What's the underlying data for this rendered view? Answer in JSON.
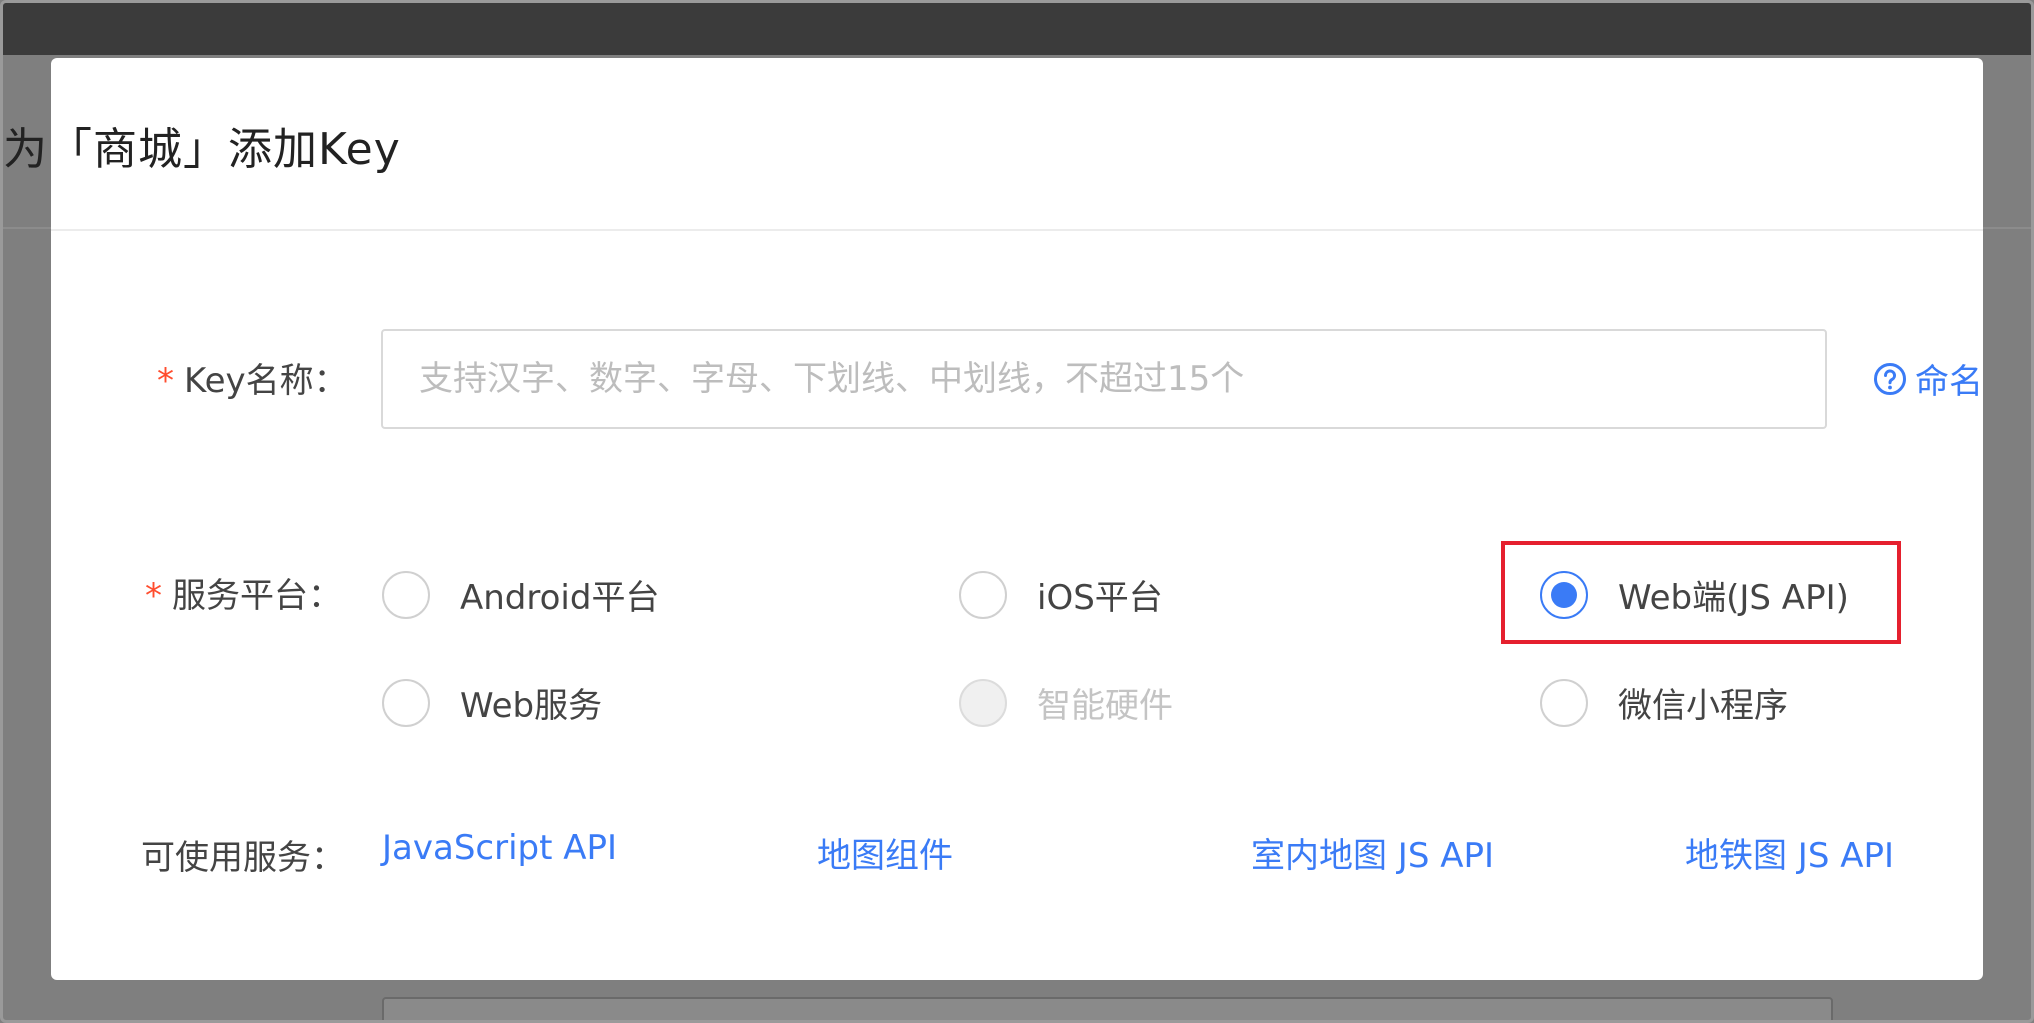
{
  "dialog": {
    "title": "为「商城」添加Key"
  },
  "key_name": {
    "required_mark": "*",
    "label": "Key名称：",
    "placeholder": "支持汉字、数字、字母、下划线、中划线，不超过15个",
    "value": "",
    "help_link": "命名规",
    "help_icon": "question-circle-icon"
  },
  "platform": {
    "required_mark": "*",
    "label": "服务平台：",
    "options": [
      {
        "label": "Android平台",
        "checked": false,
        "disabled": false
      },
      {
        "label": "iOS平台",
        "checked": false,
        "disabled": false
      },
      {
        "label": "Web端(JS API)",
        "checked": true,
        "disabled": false
      },
      {
        "label": "Web服务",
        "checked": false,
        "disabled": false
      },
      {
        "label": "智能硬件",
        "checked": false,
        "disabled": true
      },
      {
        "label": "微信小程序",
        "checked": false,
        "disabled": false
      }
    ]
  },
  "services": {
    "label": "可使用服务：",
    "links": [
      "JavaScript API",
      "地图组件",
      "室内地图 JS API",
      "地铁图 JS API"
    ]
  },
  "colors": {
    "accent": "#3a7bf6",
    "required": "#ff4d2e",
    "highlight_border": "#e5202e",
    "overlay": "#808080"
  }
}
